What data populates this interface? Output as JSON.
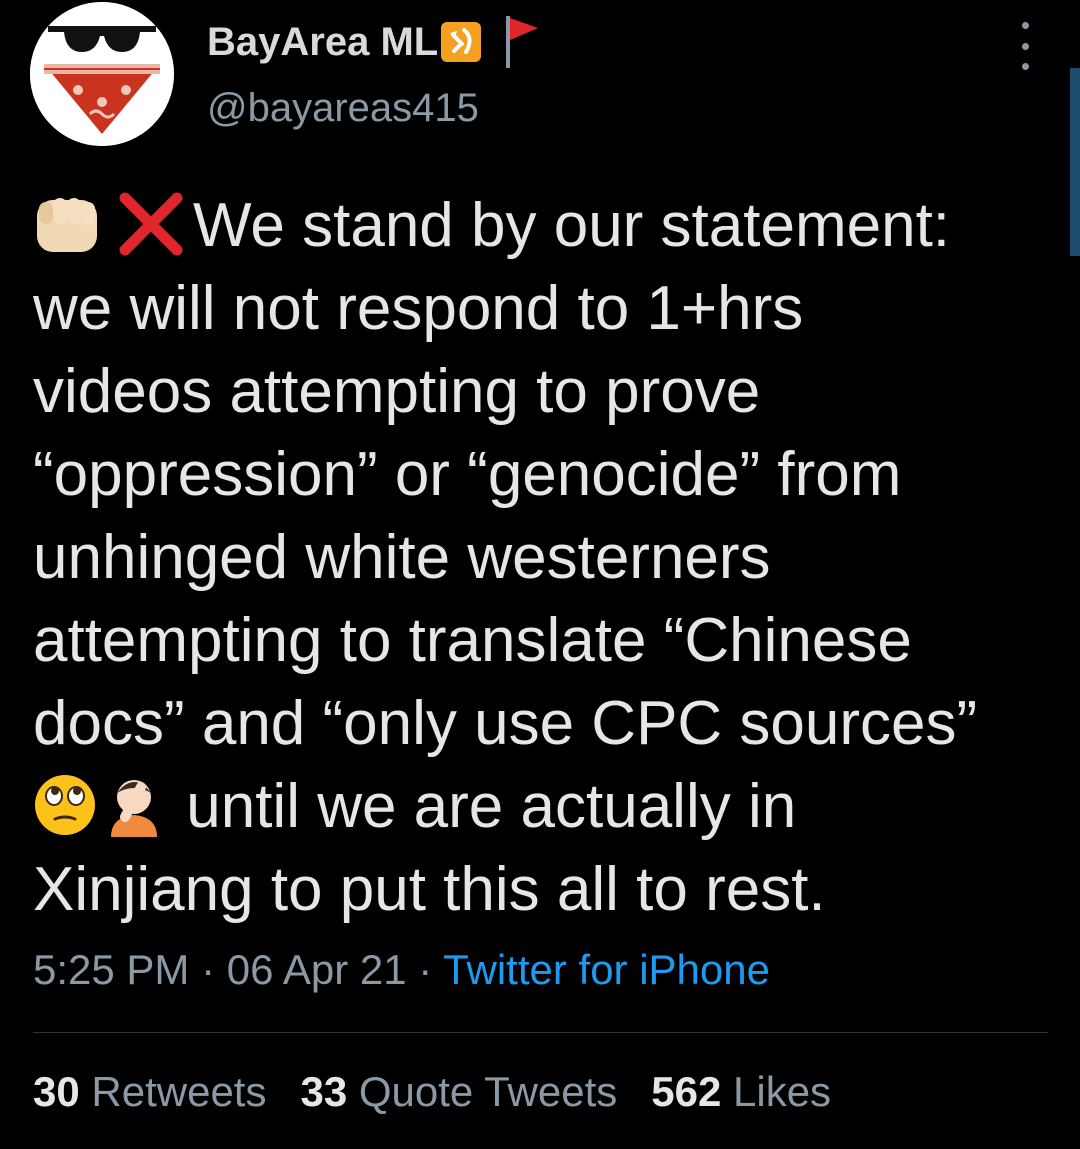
{
  "tweet": {
    "author": {
      "display_name": "BayArea ML",
      "handle": "@bayareas415",
      "avatar_icon": "bandana-sunglasses-avatar",
      "name_emojis": [
        "hammer-sickle-icon",
        "red-flag-icon"
      ]
    },
    "body_lines": [
      "We stand by our statement:",
      "we will not respond to 1+hrs",
      "videos attempting to prove",
      "“oppression” or “genocide” from",
      "unhinged white westerners",
      "attempting to translate “Chinese",
      "docs” and “only use CPC sources”",
      " until we are actually in",
      "Xinjiang to put this all to rest."
    ],
    "time": "5:25 PM",
    "separator": "·",
    "date": "06 Apr 21",
    "source": "Twitter for iPhone",
    "stats": {
      "retweets_count": "30",
      "retweets_label": "Retweets",
      "quotes_count": "33",
      "quotes_label": "Quote Tweets",
      "likes_count": "562",
      "likes_label": "Likes"
    }
  },
  "colors": {
    "background": "#000000",
    "text": "#e6e6e6",
    "secondary": "#8b98a5",
    "link": "#1d9bf0",
    "divider": "#2f3336"
  }
}
